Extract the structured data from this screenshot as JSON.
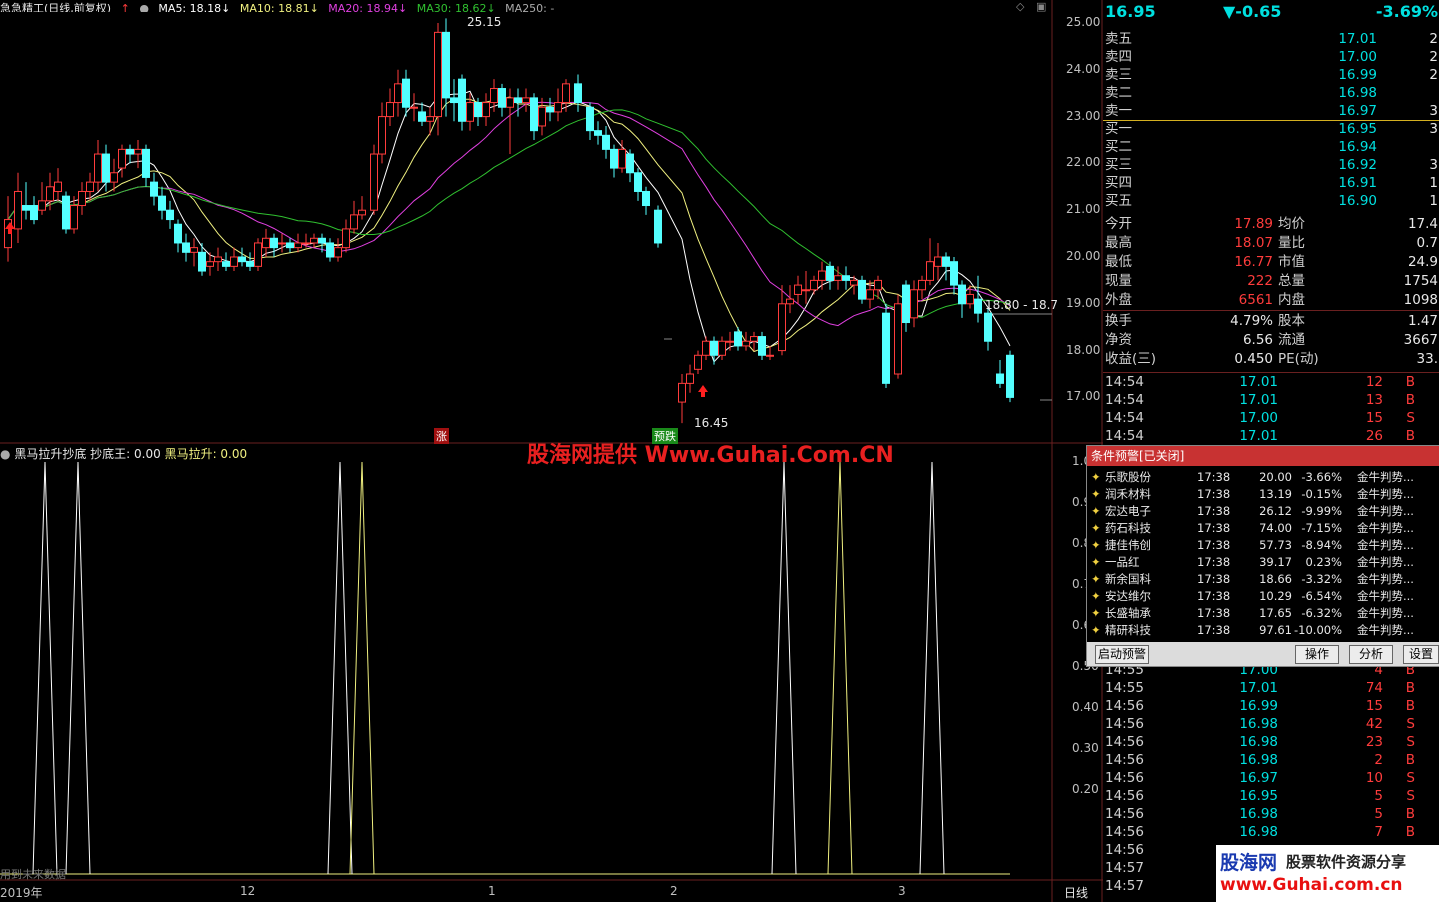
{
  "header": {
    "title": "急急精工(日线,前复权)",
    "ma5": "MA5: 18.18↓",
    "ma10": "MA10: 18.81↓",
    "ma20": "MA20: 18.94↓",
    "ma30": "MA30: 18.62↓",
    "ma250": "MA250: -"
  },
  "colors": {
    "up": "#ff3c3c",
    "down": "#54ffff",
    "ma5": "#ffffff",
    "ma10": "#f0f080",
    "ma20": "#e040e0",
    "ma30": "#30c030"
  },
  "price_axis": {
    "ticks": [
      "25.00",
      "24.00",
      "23.00",
      "22.00",
      "21.00",
      "20.00",
      "19.00",
      "18.00",
      "17.00"
    ]
  },
  "annotations": {
    "high": "25.15",
    "low": "16.45",
    "mid": "18.80 - 18.7",
    "zhang": "涨",
    "yuji": "预跌"
  },
  "indicator": {
    "title": "黑马拉升抄底",
    "cdw": "抄底王: 0.00",
    "hmls": "黑马拉升: 0.00",
    "ticks": [
      "1.0",
      "0.9",
      "0.8",
      "0.7",
      "0.6",
      "0.50",
      "0.40",
      "0.30",
      "0.20"
    ],
    "spikes_white": [
      45,
      78,
      340,
      784,
      932
    ],
    "spikes_yellow": [
      362,
      840
    ],
    "footer": "用到未来数据"
  },
  "date_axis": {
    "labels": [
      "2019年",
      "12",
      "1",
      "2",
      "3"
    ],
    "period": "日线"
  },
  "candles": [
    [
      8,
      20.2,
      20.8,
      19.9,
      21.3
    ],
    [
      18,
      20.6,
      21.4,
      20.3,
      21.8
    ],
    [
      26,
      21.1,
      21.0,
      20.8,
      21.6
    ],
    [
      34,
      21.1,
      20.8,
      20.7,
      21.3
    ],
    [
      42,
      21.0,
      21.2,
      20.9,
      21.6
    ],
    [
      50,
      21.2,
      21.5,
      21.0,
      21.8
    ],
    [
      58,
      21.4,
      21.6,
      21.2,
      21.9
    ],
    [
      66,
      21.3,
      20.6,
      20.5,
      21.4
    ],
    [
      74,
      20.6,
      21.1,
      20.5,
      21.3
    ],
    [
      82,
      21.1,
      21.4,
      20.9,
      21.6
    ],
    [
      90,
      21.4,
      21.6,
      21.2,
      21.8
    ],
    [
      98,
      21.6,
      22.2,
      21.4,
      22.5
    ],
    [
      106,
      22.2,
      21.6,
      21.4,
      22.4
    ],
    [
      114,
      21.6,
      21.8,
      21.4,
      22.1
    ],
    [
      122,
      21.9,
      22.3,
      21.7,
      22.4
    ],
    [
      130,
      22.3,
      22.2,
      22.0,
      22.4
    ],
    [
      138,
      22.2,
      22.3,
      21.9,
      22.5
    ],
    [
      146,
      22.3,
      21.7,
      21.5,
      22.4
    ],
    [
      154,
      21.6,
      21.3,
      21.1,
      21.8
    ],
    [
      162,
      21.3,
      21.0,
      20.8,
      21.5
    ],
    [
      170,
      21.0,
      20.8,
      20.6,
      21.2
    ],
    [
      178,
      20.7,
      20.3,
      20.1,
      20.8
    ],
    [
      186,
      20.3,
      20.1,
      19.9,
      20.5
    ],
    [
      194,
      20.1,
      20.2,
      19.8,
      20.4
    ],
    [
      202,
      20.1,
      19.7,
      19.6,
      20.3
    ],
    [
      210,
      19.8,
      19.9,
      19.6,
      20.1
    ],
    [
      218,
      19.9,
      20.0,
      19.7,
      20.2
    ],
    [
      226,
      19.9,
      19.8,
      19.7,
      20.1
    ],
    [
      234,
      19.8,
      20.0,
      19.7,
      20.2
    ],
    [
      242,
      20.0,
      19.9,
      19.8,
      20.2
    ],
    [
      250,
      19.9,
      19.8,
      19.7,
      20.1
    ],
    [
      258,
      19.8,
      20.3,
      19.7,
      20.4
    ],
    [
      266,
      20.2,
      20.4,
      20.0,
      20.6
    ],
    [
      274,
      20.4,
      20.2,
      20.0,
      20.5
    ],
    [
      282,
      20.3,
      20.3,
      20.1,
      20.5
    ],
    [
      290,
      20.3,
      20.2,
      20.1,
      20.4
    ],
    [
      298,
      20.2,
      20.3,
      20.1,
      20.5
    ],
    [
      306,
      20.3,
      20.3,
      20.2,
      20.5
    ],
    [
      314,
      20.3,
      20.4,
      20.2,
      20.5
    ],
    [
      322,
      20.4,
      20.3,
      20.1,
      20.5
    ],
    [
      330,
      20.3,
      20.0,
      19.9,
      20.4
    ],
    [
      338,
      20.0,
      20.2,
      19.9,
      20.4
    ],
    [
      346,
      20.2,
      20.6,
      20.1,
      20.8
    ],
    [
      354,
      20.6,
      20.9,
      20.5,
      21.2
    ],
    [
      362,
      20.9,
      21.0,
      20.8,
      21.3
    ],
    [
      374,
      21.0,
      22.2,
      20.9,
      22.4
    ],
    [
      382,
      22.2,
      23.0,
      22.0,
      23.3
    ],
    [
      390,
      23.0,
      23.3,
      22.8,
      23.6
    ],
    [
      398,
      23.3,
      23.7,
      23.0,
      24.0
    ],
    [
      406,
      23.8,
      23.2,
      23.0,
      24.0
    ],
    [
      414,
      23.2,
      23.2,
      22.9,
      23.5
    ],
    [
      422,
      23.1,
      22.9,
      22.8,
      23.3
    ],
    [
      430,
      22.9,
      23.0,
      22.6,
      23.2
    ],
    [
      438,
      23.0,
      24.8,
      22.6,
      25.0
    ],
    [
      446,
      24.8,
      23.4,
      23.0,
      25.1
    ],
    [
      454,
      23.4,
      23.3,
      22.9,
      23.8
    ],
    [
      462,
      23.8,
      22.9,
      22.7,
      23.9
    ],
    [
      470,
      22.9,
      23.3,
      22.7,
      23.5
    ],
    [
      478,
      23.3,
      23.0,
      22.8,
      23.4
    ],
    [
      486,
      23.0,
      23.3,
      22.8,
      23.5
    ],
    [
      494,
      23.3,
      23.6,
      23.1,
      23.8
    ],
    [
      502,
      23.6,
      23.2,
      23.0,
      23.7
    ],
    [
      510,
      23.2,
      23.4,
      22.2,
      23.6
    ],
    [
      518,
      23.4,
      23.3,
      23.0,
      23.6
    ],
    [
      526,
      23.3,
      23.4,
      23.1,
      23.6
    ],
    [
      534,
      23.4,
      22.7,
      22.5,
      23.5
    ],
    [
      542,
      22.8,
      23.2,
      22.6,
      23.4
    ],
    [
      550,
      23.2,
      23.1,
      22.9,
      23.4
    ],
    [
      558,
      23.1,
      23.3,
      22.9,
      23.6
    ],
    [
      566,
      23.3,
      23.7,
      23.1,
      23.8
    ],
    [
      578,
      23.7,
      23.3,
      23.1,
      23.9
    ],
    [
      590,
      23.2,
      22.7,
      22.5,
      23.3
    ],
    [
      598,
      22.7,
      22.6,
      22.4,
      22.9
    ],
    [
      606,
      22.6,
      22.3,
      22.1,
      22.8
    ],
    [
      614,
      22.3,
      21.9,
      21.7,
      22.4
    ],
    [
      622,
      21.9,
      22.3,
      21.8,
      22.5
    ],
    [
      630,
      22.2,
      21.8,
      21.6,
      22.3
    ],
    [
      638,
      21.8,
      21.4,
      21.2,
      21.9
    ],
    [
      646,
      21.4,
      21.1,
      20.9,
      21.5
    ],
    [
      658,
      21.0,
      20.3,
      20.2,
      21.1
    ],
    [
      682,
      16.9,
      17.3,
      16.45,
      17.5
    ],
    [
      690,
      17.3,
      17.5,
      17.1,
      17.7
    ],
    [
      698,
      17.6,
      17.9,
      17.5,
      18.0
    ],
    [
      706,
      17.9,
      18.2,
      17.8,
      18.3
    ],
    [
      714,
      18.2,
      17.9,
      17.7,
      18.3
    ],
    [
      722,
      17.9,
      18.2,
      17.8,
      18.3
    ],
    [
      730,
      18.2,
      18.2,
      18.0,
      18.4
    ],
    [
      738,
      18.4,
      18.1,
      18.0,
      18.5
    ],
    [
      746,
      18.1,
      18.2,
      18.0,
      18.4
    ],
    [
      754,
      18.2,
      18.3,
      18.0,
      18.4
    ],
    [
      762,
      18.3,
      17.9,
      17.8,
      18.4
    ],
    [
      770,
      17.9,
      17.9,
      17.8,
      18.1
    ],
    [
      782,
      18.0,
      19.0,
      17.9,
      19.4
    ],
    [
      790,
      19.0,
      19.1,
      18.8,
      19.4
    ],
    [
      798,
      19.2,
      19.4,
      19.0,
      19.6
    ],
    [
      806,
      19.3,
      19.3,
      19.0,
      19.7
    ],
    [
      814,
      19.3,
      19.5,
      19.2,
      19.6
    ],
    [
      822,
      19.5,
      19.7,
      19.3,
      19.9
    ],
    [
      830,
      19.8,
      19.5,
      19.3,
      19.9
    ],
    [
      838,
      19.5,
      19.6,
      19.3,
      19.8
    ],
    [
      846,
      19.6,
      19.5,
      19.3,
      19.8
    ],
    [
      854,
      19.4,
      19.5,
      19.2,
      19.6
    ],
    [
      862,
      19.5,
      19.1,
      19.0,
      19.6
    ],
    [
      870,
      19.1,
      19.3,
      18.9,
      19.5
    ],
    [
      878,
      19.3,
      19.5,
      19.1,
      19.6
    ],
    [
      886,
      18.8,
      17.3,
      17.2,
      19.0
    ],
    [
      898,
      17.5,
      19.0,
      17.4,
      19.2
    ],
    [
      906,
      19.4,
      18.6,
      18.4,
      19.5
    ],
    [
      914,
      18.7,
      19.3,
      18.5,
      19.5
    ],
    [
      922,
      19.3,
      19.5,
      19.1,
      19.6
    ],
    [
      930,
      19.5,
      19.9,
      19.4,
      20.4
    ],
    [
      938,
      19.8,
      20.0,
      19.5,
      20.3
    ],
    [
      946,
      20.0,
      19.8,
      19.5,
      20.1
    ],
    [
      954,
      19.9,
      19.4,
      19.2,
      20.0
    ],
    [
      962,
      19.4,
      19.0,
      18.7,
      19.5
    ],
    [
      970,
      19.0,
      19.2,
      18.9,
      19.4
    ],
    [
      978,
      19.1,
      18.8,
      18.6,
      19.6
    ],
    [
      988,
      18.8,
      18.2,
      18.0,
      18.9
    ],
    [
      1000,
      17.5,
      17.3,
      17.2,
      17.8
    ],
    [
      1010,
      17.9,
      17.0,
      16.9,
      18.0
    ]
  ],
  "quote": {
    "price": "16.95",
    "change": "▼-0.65",
    "pct": "-3.69%",
    "asks": [
      [
        "卖五",
        "17.01",
        "2"
      ],
      [
        "卖四",
        "17.00",
        "2"
      ],
      [
        "卖三",
        "16.99",
        "2"
      ],
      [
        "卖二",
        "16.98",
        ""
      ],
      [
        "卖一",
        "16.97",
        "3"
      ]
    ],
    "bids": [
      [
        "买一",
        "16.95",
        "3"
      ],
      [
        "买二",
        "16.94",
        ""
      ],
      [
        "买三",
        "16.92",
        "3"
      ],
      [
        "买四",
        "16.91",
        "1"
      ],
      [
        "买五",
        "16.90",
        "1"
      ]
    ],
    "stats": [
      [
        "今开",
        "17.89",
        "均价",
        "17.4"
      ],
      [
        "最高",
        "18.07",
        "量比",
        "0.7"
      ],
      [
        "最低",
        "16.77",
        "市值",
        "24.9"
      ],
      [
        "现量",
        "222",
        "总量",
        "1754"
      ],
      [
        "外盘",
        "6561",
        "内盘",
        "1098"
      ]
    ],
    "fin": [
      [
        "换手",
        "4.79%",
        "股本",
        "1.47"
      ],
      [
        "净资",
        "6.56",
        "流通",
        "3667"
      ],
      [
        "收益(三)",
        "0.450",
        "PE(动)",
        "33."
      ]
    ],
    "ticks_top": [
      [
        "14:54",
        "17.01",
        "12",
        "B"
      ],
      [
        "14:54",
        "17.01",
        "13",
        "B"
      ],
      [
        "14:54",
        "17.00",
        "15",
        "S"
      ],
      [
        "14:54",
        "17.01",
        "26",
        "B"
      ]
    ],
    "ticks_bottom": [
      [
        "14:55",
        "17.00",
        "4",
        "B"
      ],
      [
        "14:55",
        "17.01",
        "74",
        "B"
      ],
      [
        "14:56",
        "16.99",
        "15",
        "B"
      ],
      [
        "14:56",
        "16.98",
        "42",
        "S"
      ],
      [
        "14:56",
        "16.98",
        "23",
        "S"
      ],
      [
        "14:56",
        "16.98",
        "2",
        "B"
      ],
      [
        "14:56",
        "16.97",
        "10",
        "S"
      ],
      [
        "14:56",
        "16.95",
        "5",
        "S"
      ],
      [
        "14:56",
        "16.98",
        "5",
        "B"
      ],
      [
        "14:56",
        "16.98",
        "7",
        "B"
      ],
      [
        "14:56",
        "",
        "",
        " "
      ],
      [
        "14:57",
        "",
        "",
        ""
      ],
      [
        "14:57",
        "",
        "",
        ""
      ]
    ]
  },
  "alert": {
    "title": "条件预警[已关闭]",
    "rows": [
      [
        "乐歌股份",
        "17:38",
        "20.00",
        "-3.66%",
        "金牛判势..."
      ],
      [
        "润禾材料",
        "17:38",
        "13.19",
        "-0.15%",
        "金牛判势..."
      ],
      [
        "宏达电子",
        "17:38",
        "26.12",
        "-9.99%",
        "金牛判势..."
      ],
      [
        "药石科技",
        "17:38",
        "74.00",
        "-7.15%",
        "金牛判势..."
      ],
      [
        "捷佳伟创",
        "17:38",
        "57.73",
        "-8.94%",
        "金牛判势..."
      ],
      [
        "一品红",
        "17:38",
        "39.17",
        "0.23%",
        "金牛判势..."
      ],
      [
        "新余国科",
        "17:38",
        "18.66",
        "-3.32%",
        "金牛判势..."
      ],
      [
        "安达维尔",
        "17:38",
        "10.29",
        "-6.54%",
        "金牛判势..."
      ],
      [
        "长盛轴承",
        "17:38",
        "17.65",
        "-6.32%",
        "金牛判势..."
      ],
      [
        "精研科技",
        "17:38",
        "97.61",
        "-10.00%",
        "金牛判势..."
      ]
    ],
    "buttons": {
      "start": "启动预警",
      "op": "操作",
      "analyze": "分析",
      "settings": "设置"
    }
  },
  "watermark": "股海网提供 Www.Guhai.Com.CN",
  "logo": {
    "brand": "股海网",
    "slogan": "股票软件资源分享",
    "url": "www.Guhai.com.cn"
  }
}
